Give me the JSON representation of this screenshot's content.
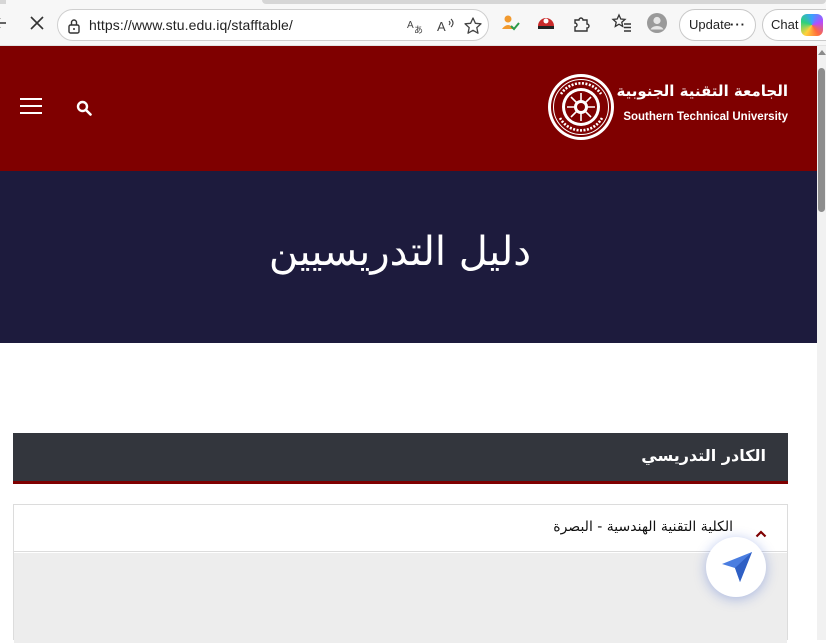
{
  "browser": {
    "url": "https://www.stu.edu.iq/stafftable/",
    "update_label": "Update",
    "update_more": "···",
    "chat_label": "Chat",
    "icons": [
      "back-icon",
      "stop-icon",
      "lock-icon",
      "translate-icon",
      "read-aloud-icon",
      "favorite-star-icon",
      "extension-colored-icon",
      "extension-red-icon",
      "puzzle-icon",
      "favorites-list-icon",
      "profile-icon",
      "more-icon",
      "copilot-icon"
    ]
  },
  "header": {
    "university_name_ar": "الجامعة التقنية الجنوبية",
    "university_name_en": "Southern Technical University",
    "brand_color": "#7f0000",
    "icons": [
      "menu-icon",
      "search-icon",
      "university-seal-logo"
    ]
  },
  "banner": {
    "title": "دليل التدريسيين",
    "background_color": "#1d1b3d"
  },
  "staff_section": {
    "title": "الكادر التدريسي",
    "header_color": "#33363d",
    "accent_color": "#7f0000",
    "accordion": [
      {
        "label": "الكلية التقنية الهندسية - البصرة",
        "expanded": true,
        "icon": "chevron-up-icon"
      }
    ]
  },
  "floating_button": {
    "icon": "send-arrow-icon"
  }
}
